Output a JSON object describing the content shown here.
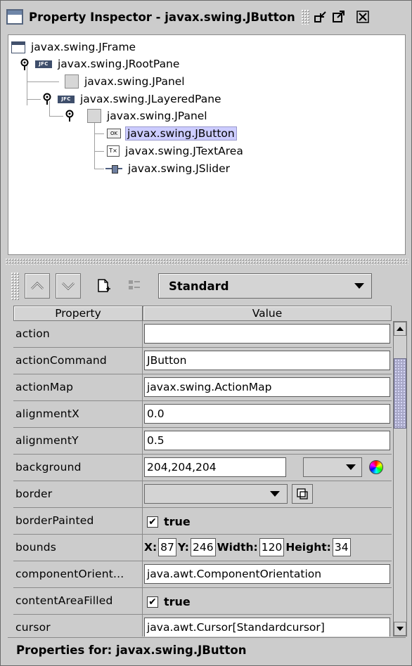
{
  "window": {
    "title": "Property Inspector - javax.swing.JButton",
    "buttons": [
      "minimize-icon",
      "maximize-icon",
      "close-icon"
    ]
  },
  "tree": {
    "nodes": [
      {
        "label": "javax.swing.JFrame",
        "icon": "frame-icon",
        "selected": false
      },
      {
        "label": "javax.swing.JRootPane",
        "icon": "jfc-icon",
        "selected": false
      },
      {
        "label": "javax.swing.JPanel",
        "icon": "panel-icon",
        "selected": false
      },
      {
        "label": "javax.swing.JLayeredPane",
        "icon": "jfc-icon",
        "selected": false
      },
      {
        "label": "javax.swing.JPanel",
        "icon": "panel-icon",
        "selected": false
      },
      {
        "label": "javax.swing.JButton",
        "icon": "button-icon",
        "selected": true
      },
      {
        "label": "javax.swing.JTextArea",
        "icon": "textarea-icon",
        "selected": false
      },
      {
        "label": "javax.swing.JSlider",
        "icon": "slider-icon",
        "selected": false
      }
    ]
  },
  "toolbar": {
    "mode": "Standard",
    "buttons": [
      "move-up-icon",
      "move-down-icon",
      "new-item-icon",
      "list-icon"
    ]
  },
  "table": {
    "headers": {
      "property": "Property",
      "value": "Value"
    },
    "rows": [
      {
        "name": "action",
        "value": ""
      },
      {
        "name": "actionCommand",
        "value": "JButton"
      },
      {
        "name": "actionMap",
        "value": "javax.swing.ActionMap"
      },
      {
        "name": "alignmentX",
        "value": "0.0"
      },
      {
        "name": "alignmentY",
        "value": "0.5"
      },
      {
        "name": "background",
        "value": "204,204,204"
      },
      {
        "name": "border",
        "value": ""
      },
      {
        "name": "borderPainted",
        "value": "true"
      },
      {
        "name": "bounds",
        "value": ""
      },
      {
        "name": "componentOrient...",
        "value": "java.awt.ComponentOrientation"
      },
      {
        "name": "contentAreaFilled",
        "value": "true"
      },
      {
        "name": "cursor",
        "value": "java.awt.Cursor[Standardcursor]"
      }
    ],
    "bounds": {
      "x_label": "X:",
      "x": "87",
      "y_label": "Y:",
      "y": "246",
      "width_label": "Width:",
      "width": "120",
      "height_label": "Height:",
      "height": "34"
    },
    "check_mark": "✔"
  },
  "status": {
    "text": "Properties for:  javax.swing.JButton"
  },
  "colors": {
    "selection": "#ccccff",
    "background": "#cccccc",
    "thumb": "#a8a8c8"
  }
}
